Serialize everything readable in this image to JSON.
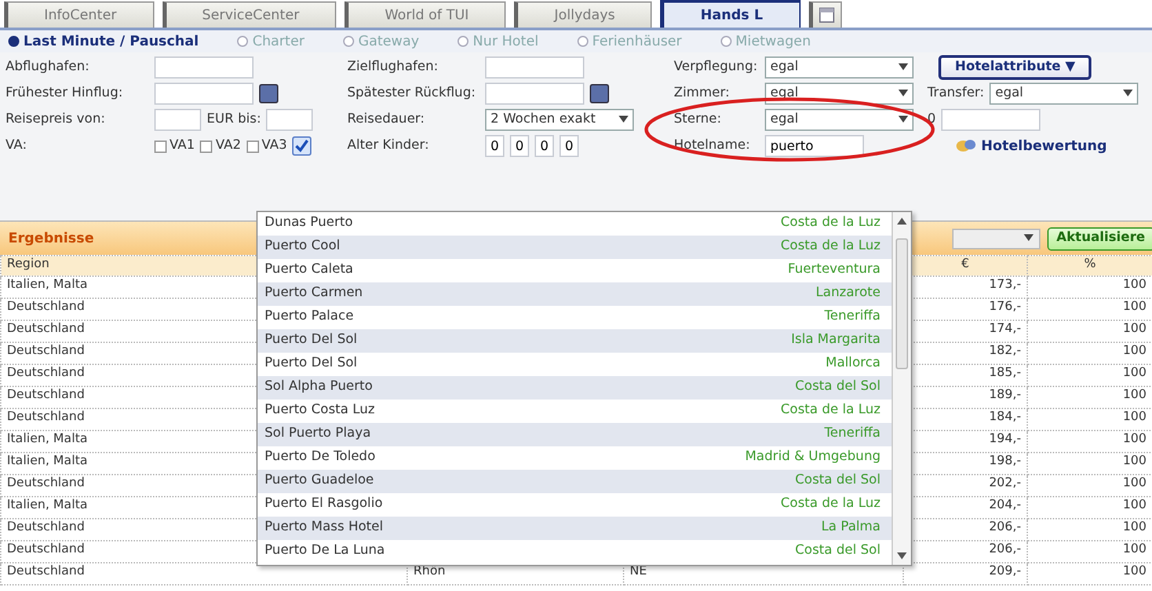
{
  "tabs": [
    {
      "label": "InfoCenter",
      "selected": false
    },
    {
      "label": "ServiceCenter",
      "selected": false
    },
    {
      "label": "World of TUI",
      "selected": false
    },
    {
      "label": "Jollydays",
      "selected": false
    },
    {
      "label": "Hands L",
      "selected": true
    },
    {
      "kind": "icon",
      "selected": false
    }
  ],
  "search_types": [
    {
      "label": "Last Minute / Pauschal",
      "selected": true
    },
    {
      "label": "Charter",
      "selected": false
    },
    {
      "label": "Gateway",
      "selected": false
    },
    {
      "label": "Nur Hotel",
      "selected": false
    },
    {
      "label": "Ferienhäuser",
      "selected": false
    },
    {
      "label": "Mietwagen",
      "selected": false
    }
  ],
  "form": {
    "rows": [
      [
        [
          {
            "kind": "label",
            "text": "Abflughafen:"
          }
        ],
        [
          {
            "kind": "input"
          }
        ],
        [
          {
            "kind": "label",
            "text": "Zielflughafen:"
          }
        ],
        [
          {
            "kind": "input"
          }
        ],
        [
          {
            "kind": "label",
            "text": "Verpflegung:"
          }
        ],
        [
          {
            "kind": "select",
            "value": "egal"
          }
        ],
        [
          {
            "kind": "button",
            "text": "Hotelattribute ▼"
          }
        ]
      ],
      [
        [
          {
            "kind": "label",
            "text": "Frühester Hinflug:"
          }
        ],
        [
          {
            "kind": "date"
          }
        ],
        [
          {
            "kind": "label",
            "text": "Spätester Rückflug:"
          }
        ],
        [
          {
            "kind": "date"
          }
        ],
        [
          {
            "kind": "label",
            "text": "Zimmer:"
          }
        ],
        [
          {
            "kind": "select",
            "value": "egal"
          }
        ],
        [
          {
            "kind": "label",
            "text": "Transfer:"
          },
          {
            "kind": "select",
            "value": "egal"
          }
        ]
      ],
      [
        [
          {
            "kind": "label",
            "text": "Reisepreis von:"
          }
        ],
        [
          {
            "kind": "small_input"
          },
          {
            "kind": "label",
            "text": "EUR bis:"
          },
          {
            "kind": "small_input"
          }
        ],
        [
          {
            "kind": "label",
            "text": "Reisedauer:"
          }
        ],
        [
          {
            "kind": "select",
            "value": "2 Wochen exakt"
          }
        ],
        [
          {
            "kind": "label",
            "text": "Sterne:"
          }
        ],
        [
          {
            "kind": "select",
            "value": "egal"
          }
        ],
        [
          {
            "kind": "label",
            "text": "0"
          },
          {
            "kind": "input"
          }
        ]
      ],
      [
        [
          {
            "kind": "label",
            "text": "VA:"
          }
        ],
        [
          {
            "kind": "checkbox",
            "text": "VA1",
            "checked": false
          },
          {
            "kind": "checkbox",
            "text": "VA2",
            "checked": false
          },
          {
            "kind": "checkbox",
            "text": "VA3",
            "checked": false
          },
          {
            "kind": "bigcheck",
            "checked": true
          }
        ],
        [
          {
            "kind": "label",
            "text": "Alter Kinder:"
          }
        ],
        [
          {
            "kind": "tiny_input",
            "value": "0"
          },
          {
            "kind": "tiny_input",
            "value": "0"
          },
          {
            "kind": "tiny_input",
            "value": "0"
          },
          {
            "kind": "tiny_input",
            "value": "0"
          }
        ],
        [
          {
            "kind": "label",
            "text": "Hotelname:"
          }
        ],
        [
          {
            "kind": "input",
            "value": "puerto"
          }
        ],
        [
          {
            "kind": "link",
            "text": "Hotelbewertung"
          }
        ]
      ]
    ]
  },
  "results": {
    "title": "Ergebnisse",
    "refresh_button": "Aktualisiere",
    "columns": [
      "Region",
      "€",
      "%"
    ],
    "rows": [
      {
        "region": "Italien, Malta",
        "price": "173,-",
        "percent": "100"
      },
      {
        "region": "Deutschland",
        "price": "176,-",
        "percent": "100"
      },
      {
        "region": "Deutschland",
        "price": "174,-",
        "percent": "100"
      },
      {
        "region": "Deutschland",
        "price": "182,-",
        "percent": "100"
      },
      {
        "region": "Deutschland",
        "price": "185,-",
        "percent": "100"
      },
      {
        "region": "Deutschland",
        "price": "189,-",
        "percent": "100"
      },
      {
        "region": "Deutschland",
        "price": "184,-",
        "percent": "100"
      },
      {
        "region": "Italien, Malta",
        "price": "194,-",
        "percent": "100"
      },
      {
        "region": "Italien, Malta",
        "price": "198,-",
        "percent": "100"
      },
      {
        "region": "Deutschland",
        "price": "202,-",
        "percent": "100"
      },
      {
        "region": "Italien, Malta",
        "price": "204,-",
        "percent": "100"
      },
      {
        "region": "Deutschland",
        "price": "206,-",
        "percent": "100"
      },
      {
        "region": "Deutschland",
        "price": "206,-",
        "percent": "100"
      },
      {
        "region": "Deutschland",
        "column_2": "Rhön",
        "column_3": "NE",
        "price": "209,-",
        "percent": "100"
      }
    ]
  },
  "hotel_suggestions": [
    {
      "name": "Dunas Puerto",
      "region": "Costa de la Luz"
    },
    {
      "name": "Puerto Cool",
      "region": "Costa de la Luz"
    },
    {
      "name": "Puerto Caleta",
      "region": "Fuerteventura"
    },
    {
      "name": "Puerto Carmen",
      "region": "Lanzarote"
    },
    {
      "name": "Puerto Palace",
      "region": "Teneriffa"
    },
    {
      "name": "Puerto Del Sol",
      "region": "Isla Margarita"
    },
    {
      "name": "Puerto Del Sol",
      "region": "Mallorca"
    },
    {
      "name": "Sol Alpha Puerto",
      "region": "Costa del Sol"
    },
    {
      "name": "Puerto Costa Luz",
      "region": "Costa de la Luz"
    },
    {
      "name": "Sol Puerto Playa",
      "region": "Teneriffa"
    },
    {
      "name": "Puerto De Toledo",
      "region": "Madrid & Umgebung"
    },
    {
      "name": "Puerto Guadeloe",
      "region": "Costa del Sol"
    },
    {
      "name": "Puerto El Rasgolio",
      "region": "Costa de la Luz"
    },
    {
      "name": "Puerto Mass Hotel",
      "region": "La Palma"
    },
    {
      "name": "Puerto De La Luna",
      "region": "Costa del Sol"
    }
  ]
}
